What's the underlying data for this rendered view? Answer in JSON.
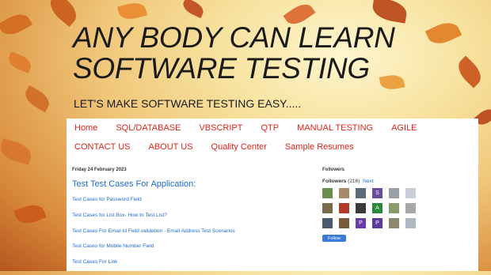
{
  "header": {
    "title_line1": "ANY BODY CAN LEARN",
    "title_line2": "SOFTWARE TESTING",
    "tagline": "LET'S MAKE SOFTWARE TESTING EASY....."
  },
  "nav": {
    "row1": [
      "Home",
      "SQL/DATABASE",
      "VBSCRIPT",
      "QTP",
      "MANUAL TESTING",
      "AGILE"
    ],
    "row2": [
      "CONTACT US",
      "ABOUT US",
      "Quality Center",
      "Sample Resumes"
    ]
  },
  "post": {
    "date": "Friday 24 February 2023",
    "title": "Test Test Cases For Application:",
    "links": [
      "Test Cases for Password Field",
      "Test Cases for List Box- How to Test List?",
      "Test Cases For Email Id Field validation - Email Address Test Scenarios",
      "Test Cases for Mobile Number Field",
      "Test Cases For Link"
    ]
  },
  "sidebar": {
    "heading": "Followers",
    "followers_label": "Followers",
    "followers_count": "(216)",
    "next_label": "Next",
    "follow_button": "Follow",
    "avatars": [
      "img",
      "img",
      "img",
      "S",
      "img",
      "img",
      "img",
      "img",
      "img",
      "A",
      "img",
      "img",
      "img",
      "img",
      "P",
      "P",
      "img",
      "img"
    ]
  },
  "colors": {
    "nav_link": "#e0241c",
    "post_link": "#1e6bd6",
    "follow_button": "#3a7bd5"
  }
}
